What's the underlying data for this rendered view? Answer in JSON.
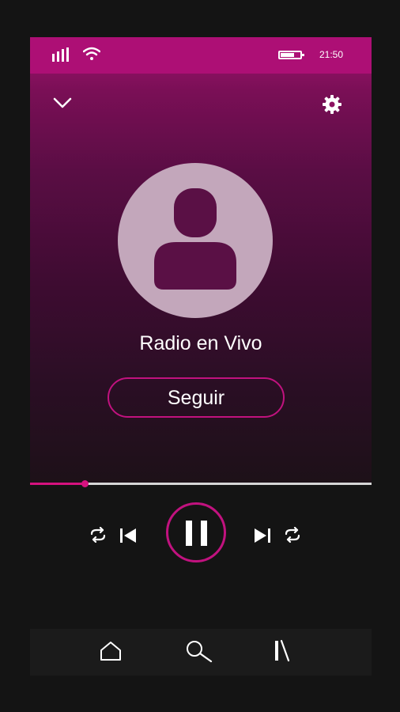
{
  "status_bar": {
    "time": "21:50",
    "battery_level": 0.6,
    "wifi": "connected",
    "signal": "full"
  },
  "header": {
    "collapse_icon": "chevron-down-icon",
    "settings_icon": "gear-icon"
  },
  "station": {
    "name": "Radio en Vivo",
    "avatar_icon": "user-icon"
  },
  "follow_button": {
    "label": "Seguir"
  },
  "playback": {
    "progress": 0.16,
    "state": "playing"
  },
  "controls": [
    "repeat-icon",
    "previous-icon",
    "pause-icon",
    "next-icon",
    "repeat-icon"
  ],
  "bottom_nav": [
    "home-icon",
    "search-icon",
    "library-icon"
  ],
  "colors": {
    "accent": "#c1127f",
    "status_bar": "#ad0f75",
    "background": "#141414",
    "avatar": "#c3a7bb"
  }
}
